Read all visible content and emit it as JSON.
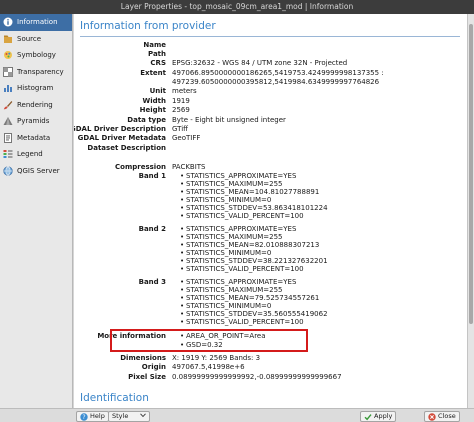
{
  "window": {
    "title": "Layer Properties - top_mosaic_09cm_area1_mod | Information"
  },
  "sidebar": {
    "items": [
      {
        "label": "Information"
      },
      {
        "label": "Source"
      },
      {
        "label": "Symbology"
      },
      {
        "label": "Transparency"
      },
      {
        "label": "Histogram"
      },
      {
        "label": "Rendering"
      },
      {
        "label": "Pyramids"
      },
      {
        "label": "Metadata"
      },
      {
        "label": "Legend"
      },
      {
        "label": "QGIS Server"
      }
    ]
  },
  "content": {
    "section_title": "Information from provider",
    "next_section_title": "Identification",
    "fields": [
      {
        "key": "Name",
        "value": ""
      },
      {
        "key": "Path",
        "value": ""
      },
      {
        "key": "CRS",
        "value": "EPSG:32632 - WGS 84 / UTM zone 32N - Projected"
      },
      {
        "key": "Extent",
        "value": "497066.8950000000186265,5419753.4249999998137355 :"
      },
      {
        "key": "",
        "value": "497239.6050000000395812,5419984.6349999997764826"
      },
      {
        "key": "Unit",
        "value": "meters"
      },
      {
        "key": "Width",
        "value": "1919"
      },
      {
        "key": "Height",
        "value": "2569"
      },
      {
        "key": "Data type",
        "value": "Byte - Eight bit unsigned integer"
      },
      {
        "key": "GDAL Driver Description",
        "value": "GTiff"
      },
      {
        "key": "GDAL Driver Metadata",
        "value": "GeoTIFF"
      },
      {
        "key": "Dataset Description",
        "value": ""
      }
    ],
    "compression": {
      "key": "Compression",
      "value": "PACKBITS"
    },
    "bands": [
      {
        "key": "Band 1",
        "stats": [
          "STATISTICS_APPROXIMATE=YES",
          "STATISTICS_MAXIMUM=255",
          "STATISTICS_MEAN=104.81027788891",
          "STATISTICS_MINIMUM=0",
          "STATISTICS_STDDEV=53.863418101224",
          "STATISTICS_VALID_PERCENT=100"
        ]
      },
      {
        "key": "Band 2",
        "stats": [
          "STATISTICS_APPROXIMATE=YES",
          "STATISTICS_MAXIMUM=255",
          "STATISTICS_MEAN=82.010888307213",
          "STATISTICS_MINIMUM=0",
          "STATISTICS_STDDEV=38.221327632201",
          "STATISTICS_VALID_PERCENT=100"
        ]
      },
      {
        "key": "Band 3",
        "stats": [
          "STATISTICS_APPROXIMATE=YES",
          "STATISTICS_MAXIMUM=255",
          "STATISTICS_MEAN=79.525734557261",
          "STATISTICS_MINIMUM=0",
          "STATISTICS_STDDEV=35.560555419062",
          "STATISTICS_VALID_PERCENT=100"
        ]
      }
    ],
    "more_information": {
      "key": "More information",
      "items": [
        "AREA_OR_POINT=Area",
        "GSD=0.32"
      ]
    },
    "dimensions": {
      "key": "Dimensions",
      "value": "X: 1919 Y: 2569 Bands: 3"
    },
    "origin": {
      "key": "Origin",
      "value": "497067.5,41998e+6"
    },
    "pixel_size": {
      "key": "Pixel Size",
      "value": "0.08999999999999992,-0.08999999999999667"
    }
  },
  "buttons": {
    "help": "Help",
    "style": "Style",
    "apply": "Apply",
    "close": "Close"
  },
  "colors": {
    "accent": "#3d6ea5",
    "section_title": "#3a84c8",
    "highlight_border": "#d41b1b"
  }
}
